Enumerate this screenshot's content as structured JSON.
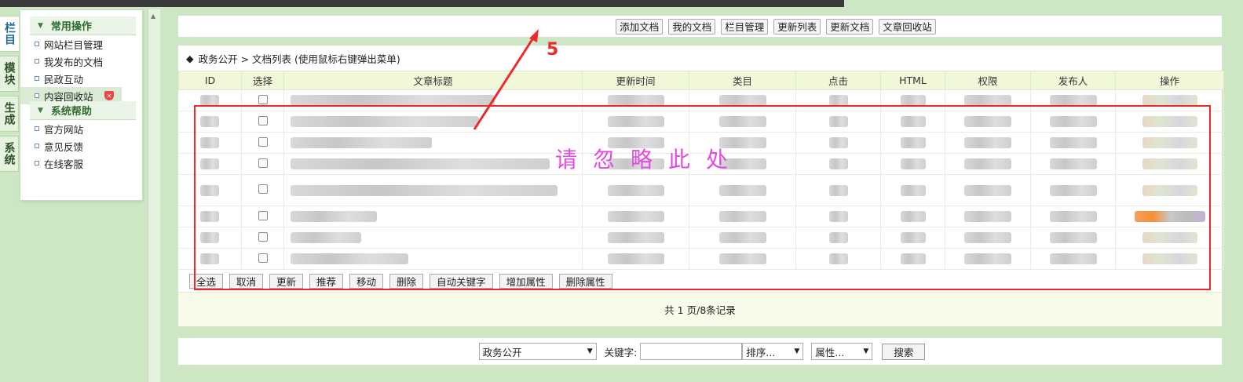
{
  "vtabs": [
    "栏目",
    "模块",
    "生成",
    "系统"
  ],
  "menu": {
    "group1_title": "常用操作",
    "group1_items": [
      "网站栏目管理",
      "我发布的文档",
      "民政互动",
      "内容回收站"
    ],
    "group2_title": "系统帮助",
    "group2_items": [
      "官方网站",
      "意见反馈",
      "在线客服"
    ]
  },
  "toolbar": [
    "添加文档",
    "我的文档",
    "栏目管理",
    "更新列表",
    "更新文档",
    "文章回收站"
  ],
  "breadcrumb": {
    "diamond": "◆",
    "text": "政务公开 > 文档列表  (使用鼠标右键弹出菜单)"
  },
  "table": {
    "columns": [
      "ID",
      "选择",
      "文章标题",
      "更新时间",
      "类目",
      "点击",
      "HTML",
      "权限",
      "发布人",
      "操作"
    ],
    "row_count": 8
  },
  "annotation": {
    "number": "5",
    "watermark": "请忽略此处"
  },
  "actions": [
    "全选",
    "取消",
    "更新",
    "推荐",
    "移动",
    "删除",
    "自动关键字",
    "增加属性",
    "删除属性"
  ],
  "pager_text": "共 1 页/8条记录",
  "search": {
    "category": "政务公开",
    "keyword_label": "关键字:",
    "keyword_value": "",
    "sort": "排序...",
    "attr": "属性...",
    "button": "搜索"
  },
  "colors": {
    "background": "#cde7c5",
    "frame": "#ee2a2a",
    "watermark": "#e24ae2"
  }
}
